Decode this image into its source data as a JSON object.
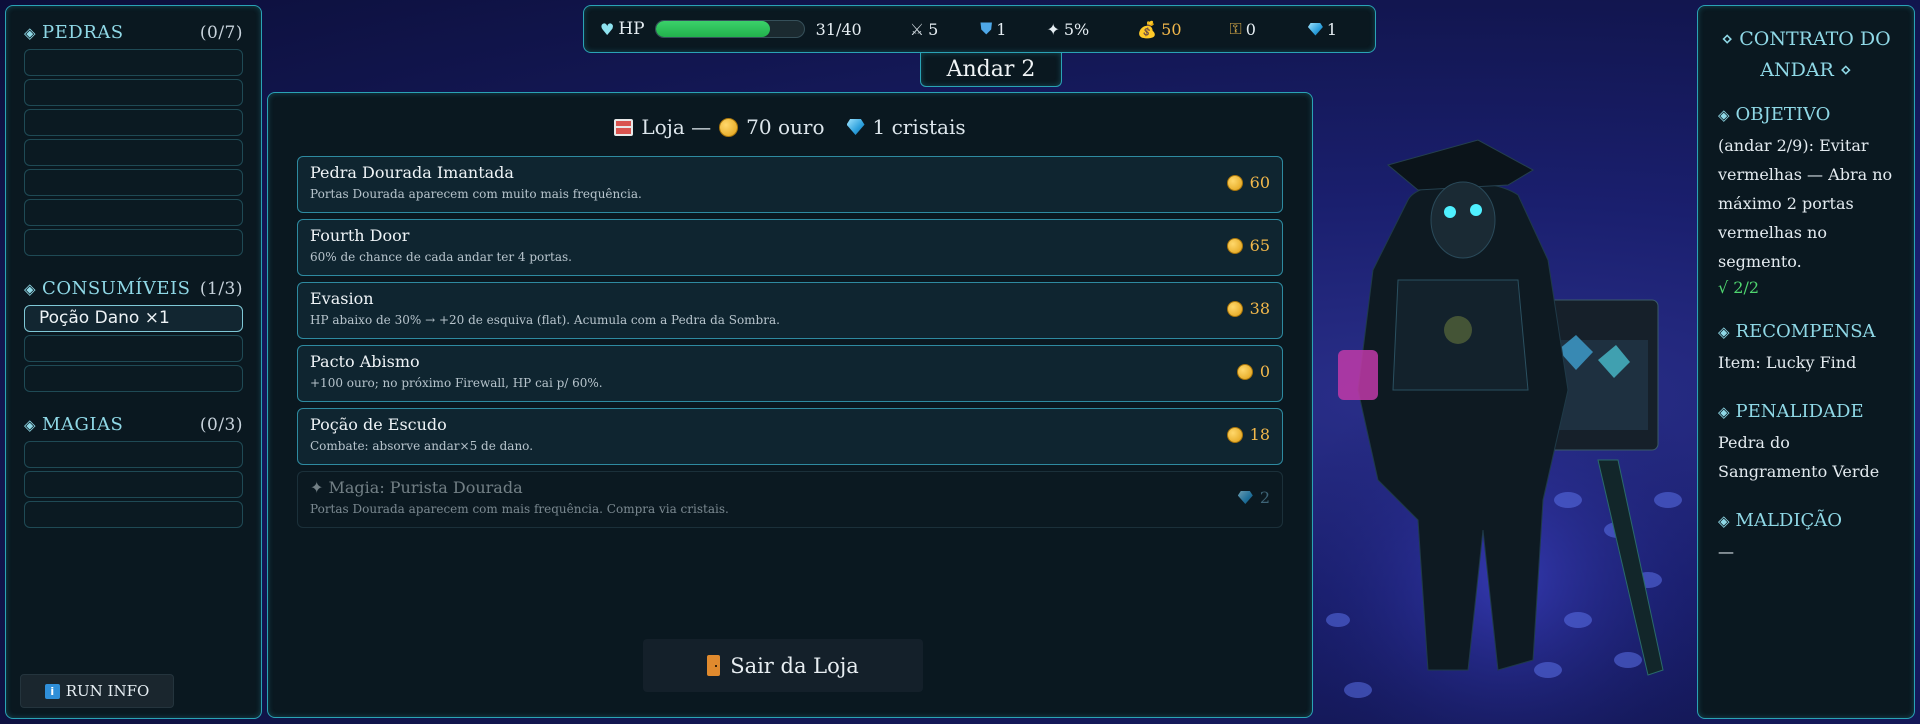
{
  "left_panel": {
    "stones": {
      "title": "PEDRAS",
      "count": "(0/7)",
      "slots": 7
    },
    "consumables": {
      "title": "CONSUMÍVEIS",
      "count": "(1/3)",
      "items": [
        "Poção Dano ×1"
      ]
    },
    "spells": {
      "title": "MAGIAS",
      "count": "(0/3)"
    },
    "run_info_label": "RUN INFO"
  },
  "hud": {
    "hp_label": "HP",
    "hp_text": "31/40",
    "hp_fraction": 0.775,
    "attack": "5",
    "defense": "1",
    "crit": "5%",
    "gold": "50",
    "keys": "0",
    "gems": "1"
  },
  "floor_label": "Andar 2",
  "shop": {
    "title_prefix": "Loja —",
    "gold_text": "70 ouro",
    "crystals_text": "1 cristais",
    "items": [
      {
        "name": "Pedra Dourada Imantada",
        "desc": "Portas Dourada aparecem com muito mais frequência.",
        "price": "60",
        "currency": "gold",
        "enabled": true
      },
      {
        "name": "Fourth Door",
        "desc": "60% de chance de cada andar ter 4 portas.",
        "price": "65",
        "currency": "gold",
        "enabled": true
      },
      {
        "name": "Evasion",
        "desc": "HP abaixo de 30% → +20 de esquiva (flat). Acumula com a Pedra da Sombra.",
        "price": "38",
        "currency": "gold",
        "enabled": true
      },
      {
        "name": "Pacto Abismo",
        "desc": "+100 ouro; no próximo Firewall, HP cai p/ 60%.",
        "price": "0",
        "currency": "gold",
        "enabled": true
      },
      {
        "name": "Poção de Escudo",
        "desc": "Combate: absorve andar×5 de dano.",
        "price": "18",
        "currency": "gold",
        "enabled": true
      },
      {
        "name": "✦ Magia: Purista Dourada",
        "desc": "Portas Dourada aparecem com mais frequência. Compra via cristais.",
        "price": "2",
        "currency": "crystal",
        "enabled": false
      }
    ],
    "exit_label": "Sair da Loja"
  },
  "contract": {
    "title": "⋄ CONTRATO DO ANDAR ⋄",
    "objective_head": "OBJETIVO",
    "objective_text": "(andar 2/9): Evitar vermelhas — Abra no máximo 2 portas vermelhas no segmento.",
    "objective_progress": "√ 2/2",
    "reward_head": "RECOMPENSA",
    "reward_text": "Item: Lucky Find",
    "penalty_head": "PENALIDADE",
    "penalty_text": "Pedra do Sangramento Verde",
    "curse_head": "MALDIÇÃO",
    "curse_text": "—"
  },
  "colors": {
    "accent": "#2aa3b5",
    "heading": "#8fd8e6",
    "gold": "#f2b84b",
    "hp_green": "#22b14c",
    "ok_green": "#4fd56f"
  }
}
